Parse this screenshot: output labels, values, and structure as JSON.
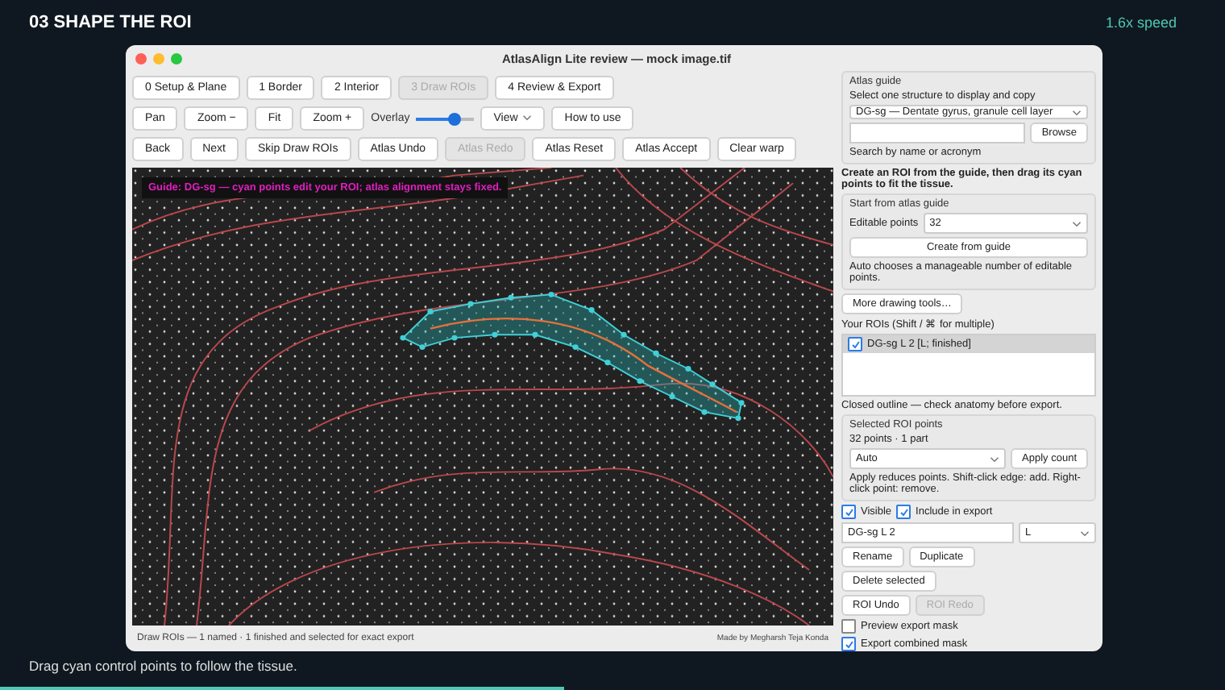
{
  "header": {
    "step_title": "03  SHAPE THE ROI",
    "speed": "1.6x speed"
  },
  "window": {
    "title": "AtlasAlign Lite review — mock image.tif"
  },
  "steps": [
    {
      "label": "0 Setup & Plane",
      "selected": false
    },
    {
      "label": "1 Border",
      "selected": false
    },
    {
      "label": "2 Interior",
      "selected": false
    },
    {
      "label": "3 Draw ROIs",
      "selected": true
    },
    {
      "label": "4 Review & Export",
      "selected": false
    }
  ],
  "toolbar": [
    {
      "kind": "button",
      "label": "Pan"
    },
    {
      "kind": "button",
      "label": "Zoom −"
    },
    {
      "kind": "button",
      "label": "Fit"
    },
    {
      "kind": "button",
      "label": "Zoom +"
    },
    {
      "kind": "label",
      "label": "Overlay"
    },
    {
      "kind": "slider",
      "level": 0.65
    },
    {
      "kind": "menu",
      "label": "View"
    },
    {
      "kind": "button",
      "label": "How to use"
    }
  ],
  "actions": [
    {
      "label": "Back",
      "disabled": false
    },
    {
      "label": "Next",
      "disabled": false
    },
    {
      "label": "Skip Draw ROIs",
      "disabled": false
    },
    {
      "label": "Atlas Undo",
      "disabled": false
    },
    {
      "label": "Atlas Redo",
      "disabled": true
    },
    {
      "label": "Atlas Reset",
      "disabled": false
    },
    {
      "label": "Atlas Accept",
      "disabled": false
    },
    {
      "label": "Clear warp",
      "disabled": false
    }
  ],
  "image": {
    "guide_text": "Guide: DG-sg — cyan points edit your ROI; atlas alignment stays fixed."
  },
  "status_bar": {
    "left": "Draw ROIs — 1 named · 1 finished and selected for exact export",
    "right": "Made by Megharsh Teja Konda"
  },
  "atlas_guide": {
    "title": "Atlas guide",
    "prompt": "Select one structure to display and copy",
    "structure": "DG-sg — Dentate gyrus, granule cell layer",
    "browse_button": "Browse",
    "hint": "Search by name or acronym"
  },
  "instruction": "Create an ROI from the guide, then drag its cyan points to fit the tissue.",
  "start_group": {
    "title": "Start from atlas guide",
    "points_label": "Editable points",
    "points_value": "32",
    "create_button": "Create from guide",
    "note": "Auto chooses a manageable number of editable points."
  },
  "more_tools_button": "More drawing tools…",
  "rois": {
    "label": "Your ROIs (Shift / ⌘ for multiple)",
    "items": [
      {
        "label": "DG-sg L 2  [L; finished]",
        "checked": true,
        "selected": true
      }
    ],
    "note": "Closed outline — check anatomy before export."
  },
  "points_group": {
    "title": "Selected ROI points",
    "count": "32 points · 1 part",
    "mode": "Auto",
    "apply_button": "Apply count",
    "note": "Apply reduces points. Shift-click edge: add. Right-click point: remove."
  },
  "roi_options": [
    {
      "label": "Visible",
      "checked": true
    },
    {
      "label": "Include in export",
      "checked": true
    }
  ],
  "name_field": {
    "value": "DG-sg L 2"
  },
  "side_select": {
    "value": "L"
  },
  "roi_button_rows": [
    [
      {
        "label": "Rename",
        "disabled": false
      },
      {
        "label": "Duplicate",
        "disabled": false
      }
    ],
    [
      {
        "label": "Delete selected",
        "disabled": false
      }
    ],
    [
      {
        "label": "ROI Undo",
        "disabled": false
      },
      {
        "label": "ROI Redo",
        "disabled": true
      }
    ]
  ],
  "export_options": [
    {
      "label": "Preview export mask",
      "checked": false
    },
    {
      "label": "Export combined mask",
      "checked": true
    }
  ],
  "caption": "Drag cyan control points to follow the tissue.",
  "progress": {
    "level": 0.46
  }
}
